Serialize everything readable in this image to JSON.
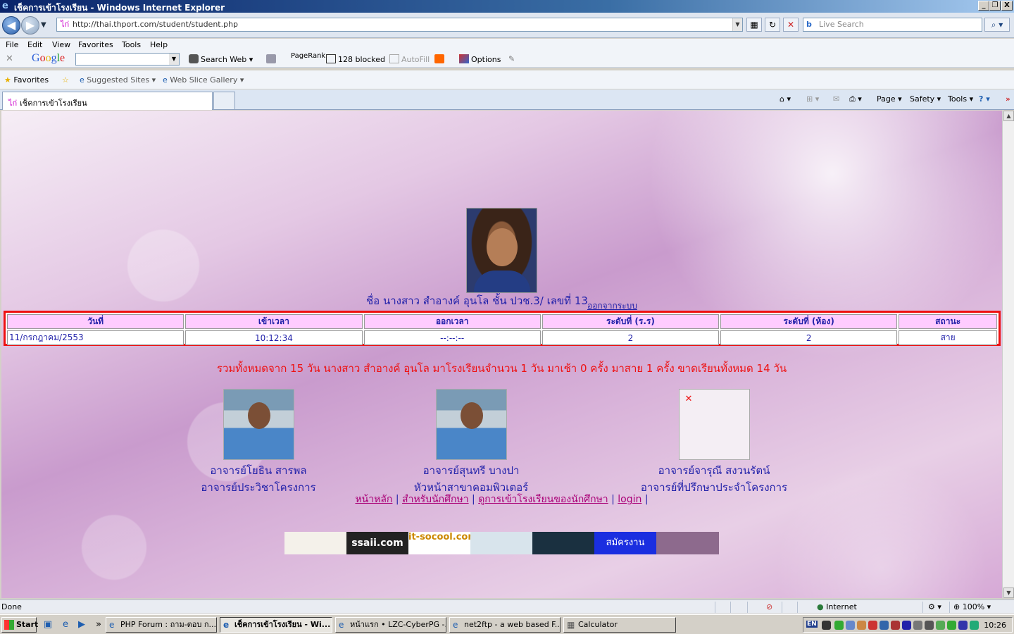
{
  "window": {
    "title": "เช็คการเข้าโรงเรียน - Windows Internet Explorer",
    "minimize": "_",
    "restore": "❐",
    "close": "X"
  },
  "address": {
    "url": "http://thai.thport.com/student/student.php",
    "search_placeholder": "Live Search"
  },
  "menu": [
    "File",
    "Edit",
    "View",
    "Favorites",
    "Tools",
    "Help"
  ],
  "google_toolbar": {
    "logo": "Google",
    "search_web": "Search Web",
    "pagerank": "PageRank",
    "blocked": "128 blocked",
    "autofill": "AutoFill",
    "options": "Options"
  },
  "favorites_bar": {
    "favorites": "Favorites",
    "suggested_sites": "Suggested Sites",
    "web_slice_gallery": "Web Slice Gallery"
  },
  "tab": {
    "title": "เช็คการเข้าโรงเรียน"
  },
  "command_bar": {
    "page": "Page",
    "safety": "Safety",
    "tools": "Tools"
  },
  "student": {
    "name_line": "ชื่อ นางสาว สำอางค์ อุนโล ชั้น ปวช.3/ เลขที่ 13",
    "logout": "ออกจากระบบ"
  },
  "attendance": {
    "headers": [
      "วันที่",
      "เข้าเวลา",
      "ออกเวลา",
      "ระดับที่ (ร.ร)",
      "ระดับที่ (ห้อง)",
      "สถานะ"
    ],
    "rows": [
      [
        "11/กรกฎาคม/2553",
        "10:12:34",
        "--:--:--",
        "2",
        "2",
        "สาย"
      ]
    ]
  },
  "summary": "รวมทั้งหมดจาก 15 วัน นางสาว สำอางค์ อุนโล มาโรงเรียนจำนวน 1 วัน มาเช้า 0 ครั้ง มาสาย 1 ครั้ง ขาดเรียนทั้งหมด 14 วัน",
  "teachers": [
    {
      "name": "อาจารย์โยธิน สารพล",
      "role": "อาจารย์ประวิชาโครงการ"
    },
    {
      "name": "อาจารย์สุนทรี บางปา",
      "role": "หัวหน้าสาขาคอมพิวเตอร์"
    },
    {
      "name": "อาจารย์จารุณี สงวนรัตน์",
      "role": "อาจารย์ที่ปรึกษาประจำโครงการ"
    }
  ],
  "footer_links": [
    "หน้าหลัก",
    "สำหรับนักศึกษา",
    "ดูการเข้าโรงเรียนของนักศึกษา",
    "login"
  ],
  "banners": [
    "",
    "ssaii.com",
    "it-socool.com",
    "",
    "",
    "สมัครงาน",
    ""
  ],
  "statusbar": {
    "left": "Done",
    "zone": "Internet",
    "zoom": "100%"
  },
  "taskbar": {
    "start": "Start",
    "buttons": [
      "PHP Forum : ถาม-ตอบ ก...",
      "เช็คการเข้าโรงเรียน - Wi...",
      "หน้าแรก • LZC-CyberPG -...",
      "net2ftp - a web based F...",
      "Calculator"
    ],
    "lang": "EN",
    "clock": "10:26"
  }
}
